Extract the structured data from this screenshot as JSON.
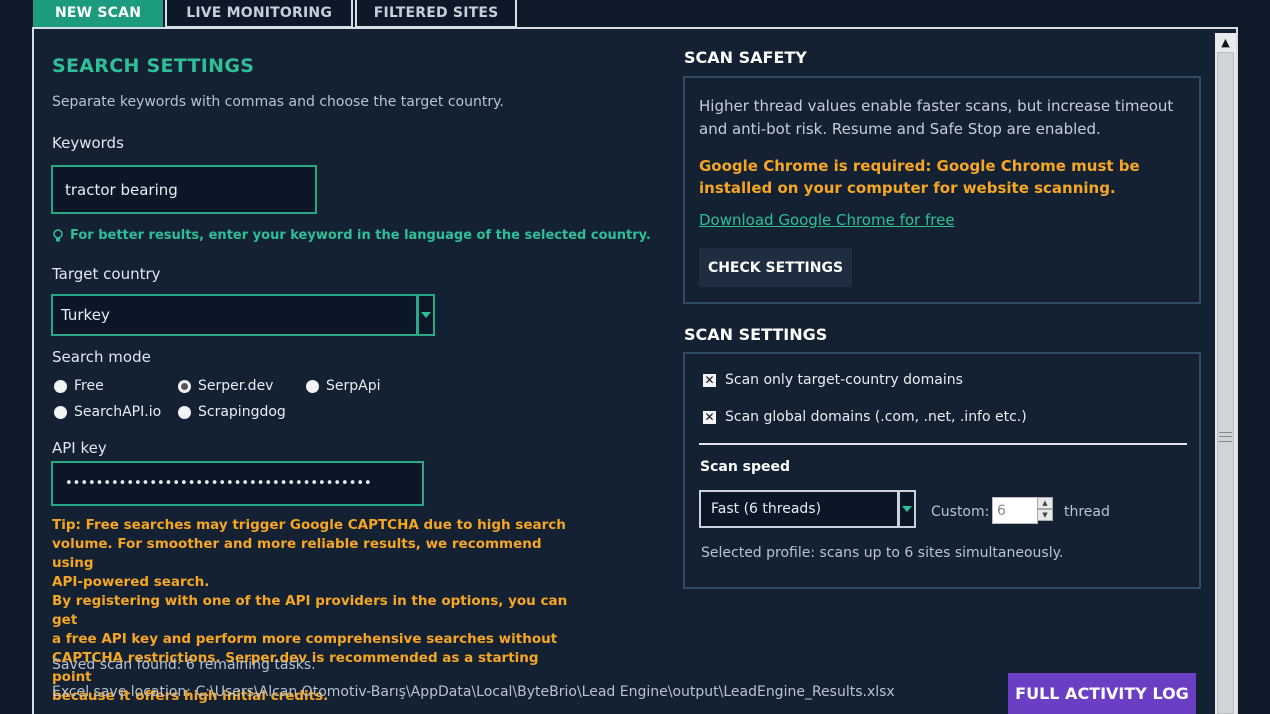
{
  "tabs": [
    "NEW SCAN",
    "LIVE MONITORING",
    "FILTERED SITES"
  ],
  "search": {
    "title": "SEARCH SETTINGS",
    "subtitle": "Separate keywords with commas and choose the target country.",
    "keywords_label": "Keywords",
    "keywords_value": "tractor bearing",
    "keyword_hint": "For better results, enter your keyword in the language of the selected country.",
    "country_label": "Target country",
    "country_value": "Turkey",
    "mode_label": "Search mode",
    "modes": [
      "Free",
      "Serper.dev",
      "SerpApi",
      "SearchAPI.io",
      "Scrapingdog"
    ],
    "selected_mode": "Serper.dev",
    "api_label": "API key",
    "api_value": "••••••••••••••••••••••••••••••••••••••••",
    "tip_lines": [
      "Tip: Free searches may trigger Google CAPTCHA due to high search",
      "volume. For smoother and more reliable results, we recommend using",
      "API-powered search.",
      "By registering with one of the API providers in the options, you can get",
      "a free API key and perform more comprehensive searches without",
      "CAPTCHA restrictions. Serper.dev is recommended as a starting point",
      "because it offers high initial credits."
    ],
    "saved_scan": "Saved scan found: 6 remaining tasks.",
    "excel_label": "Excel save location:",
    "excel_path": "C:\\Users\\Alcan Otomotiv-Barış\\AppData\\Local\\ByteBrio\\Lead Engine\\output\\LeadEngine_Results.xlsx"
  },
  "safety": {
    "title": "SCAN SAFETY",
    "text_lines": [
      "Higher thread values enable faster scans, but increase timeout",
      "and anti-bot risk. Resume and Safe Stop are enabled."
    ],
    "chrome_lines": [
      "Google Chrome is required: Google Chrome must be",
      "installed on your computer for website scanning."
    ],
    "download_link": "Download Google Chrome for free",
    "check_button": "CHECK SETTINGS"
  },
  "scan_settings": {
    "title": "SCAN SETTINGS",
    "option1": "Scan only target-country domains",
    "option2": "Scan global domains (.com, .net, .info etc.)",
    "speed_label": "Scan speed",
    "speed_value": "Fast (6 threads)",
    "custom_label": "Custom:",
    "custom_value": "6",
    "thread_label": "thread",
    "profile_text": "Selected profile: scans up to 6 sites simultaneously."
  },
  "log_button": "FULL ACTIVITY LOG",
  "colors": {
    "accent": "#2ebf97",
    "warning": "#f5a623",
    "purple": "#6b3fc4",
    "background": "#0e1a2a"
  }
}
